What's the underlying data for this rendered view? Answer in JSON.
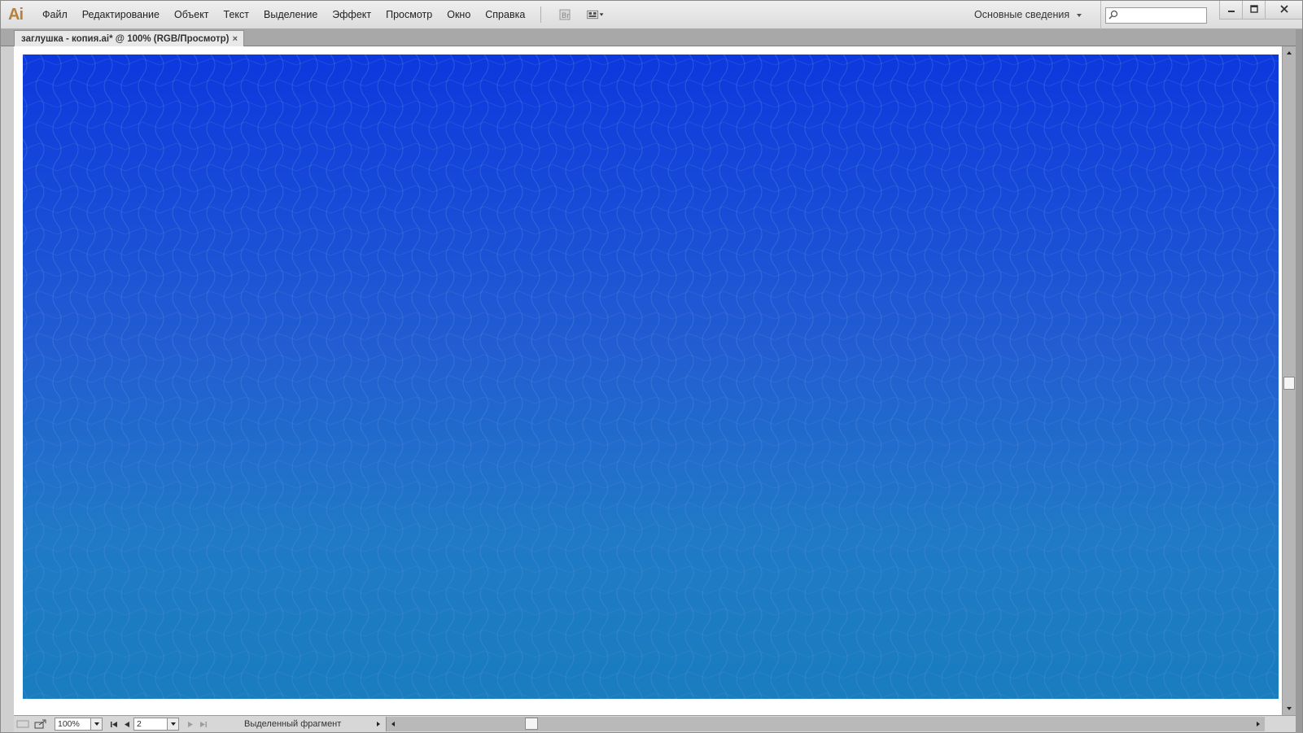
{
  "app": {
    "logo": "Ai",
    "accent": "#b5813d"
  },
  "menu": {
    "items": [
      "Файл",
      "Редактирование",
      "Объект",
      "Текст",
      "Выделение",
      "Эффект",
      "Просмотр",
      "Окно",
      "Справка"
    ]
  },
  "toolbar": {
    "bridge_icon": "bridge-icon",
    "arrange_icon": "arrange-documents-icon"
  },
  "workspace": {
    "label": "Основные сведения",
    "icon": "chevron-down-icon"
  },
  "search": {
    "placeholder": "",
    "icon": "search-icon"
  },
  "window_controls": {
    "minimize": "minimize-icon",
    "maximize": "maximize-icon",
    "close": "close-icon"
  },
  "document_tab": {
    "title": "заглушка - копия.ai* @ 100% (RGB/Просмотр)",
    "close": "×"
  },
  "artboard": {
    "gradient_top": "#002ddc",
    "gradient_bottom": "#197dbe",
    "pattern_color": "#5a8fe0"
  },
  "statusbar": {
    "zoom": "100%",
    "page": "2",
    "status_text": "Выделенный фрагмент"
  }
}
